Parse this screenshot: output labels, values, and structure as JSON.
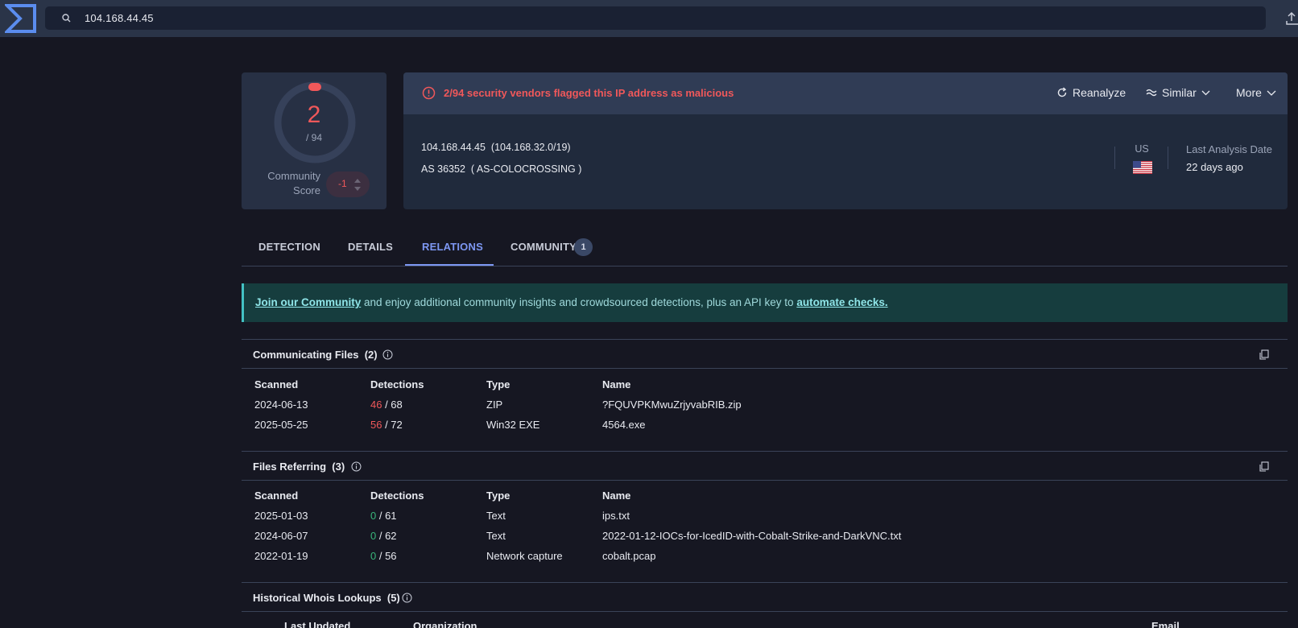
{
  "search": {
    "value": "104.168.44.45"
  },
  "score": {
    "value": "2",
    "total": "/ 94",
    "community_label_1": "Community",
    "community_label_2": "Score",
    "community_value": "-1"
  },
  "header": {
    "alert": "2/94 security vendors flagged this IP address as malicious",
    "reanalyze": "Reanalyze",
    "similar": "Similar",
    "more": "More"
  },
  "info": {
    "ip": "104.168.44.45",
    "cidr": "(104.168.32.0/19)",
    "as_number": "AS 36352",
    "as_name": "( AS-COLOCROSSING )",
    "country": "US",
    "last_analysis_label": "Last Analysis Date",
    "last_analysis_value": "22 days ago"
  },
  "tabs": [
    {
      "label": "DETECTION"
    },
    {
      "label": "DETAILS"
    },
    {
      "label": "RELATIONS"
    },
    {
      "label": "COMMUNITY",
      "badge": "1"
    }
  ],
  "banner": {
    "link1": "Join our Community",
    "middle": " and enjoy additional community insights and crowdsourced detections, plus an API key to ",
    "link2": "automate checks."
  },
  "communicating": {
    "title": "Communicating Files",
    "count": "(2)",
    "columns": [
      "Scanned",
      "Detections",
      "Type",
      "Name"
    ],
    "rows": [
      {
        "scanned": "2024-06-13",
        "det": "46",
        "total": " / 68",
        "type": "ZIP",
        "name": "?FQUVPKMwuZrjyvabRIB.zip"
      },
      {
        "scanned": "2025-05-25",
        "det": "56",
        "total": " / 72",
        "type": "Win32 EXE",
        "name": "4564.exe"
      }
    ]
  },
  "referring": {
    "title": "Files Referring",
    "count": "(3)",
    "columns": [
      "Scanned",
      "Detections",
      "Type",
      "Name"
    ],
    "rows": [
      {
        "scanned": "2025-01-03",
        "det": "0",
        "total": " / 61",
        "type": "Text",
        "name": "ips.txt"
      },
      {
        "scanned": "2024-06-07",
        "det": "0",
        "total": " / 62",
        "type": "Text",
        "name": "2022-01-12-IOCs-for-IcedID-with-Cobalt-Strike-and-DarkVNC.txt"
      },
      {
        "scanned": "2022-01-19",
        "det": "0",
        "total": " / 56",
        "type": "Network capture",
        "name": "cobalt.pcap"
      }
    ]
  },
  "whois": {
    "title": "Historical Whois Lookups",
    "count": "(5)",
    "columns": [
      "Last Updated",
      "Organization",
      "Email"
    ]
  }
}
